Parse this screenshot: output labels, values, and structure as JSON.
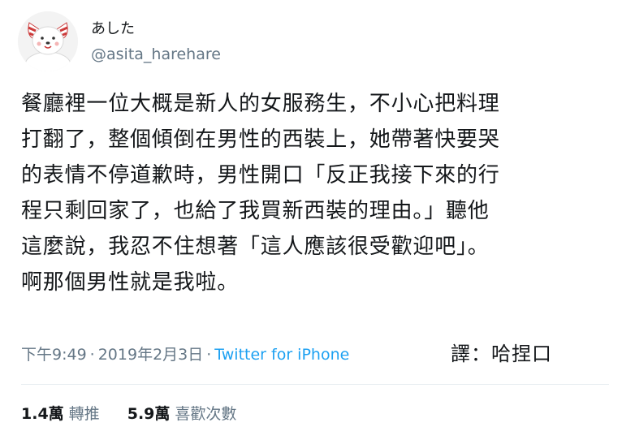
{
  "user": {
    "display_name": "あした",
    "handle": "@asita_harehare",
    "avatar_icon": "dog-avatar-icon"
  },
  "tweet": {
    "lines": [
      "餐廳裡一位大概是新人的女服務生，不小心把料理",
      "打翻了，整個傾倒在男性的西裝上，她帶著快要哭",
      "的表情不停道歉時，男性開口「反正我接下來的行",
      "程只剩回家了，也給了我買新西裝的理由。」聽他",
      "這麼說，我忍不住想著「這人應該很受歡迎吧」。",
      "啊那個男性就是我啦。"
    ]
  },
  "meta": {
    "time": "下午9:49",
    "separator": "·",
    "date": "2019年2月3日",
    "source": "Twitter for iPhone"
  },
  "translator": "譯：哈捏口",
  "stats": {
    "retweets": {
      "count": "1.4萬",
      "label": "轉推"
    },
    "likes": {
      "count": "5.9萬",
      "label": "喜歡次數"
    }
  },
  "colors": {
    "text": "#14171a",
    "muted": "#657786",
    "link": "#1da1f2",
    "divider": "#e6ecf0"
  }
}
